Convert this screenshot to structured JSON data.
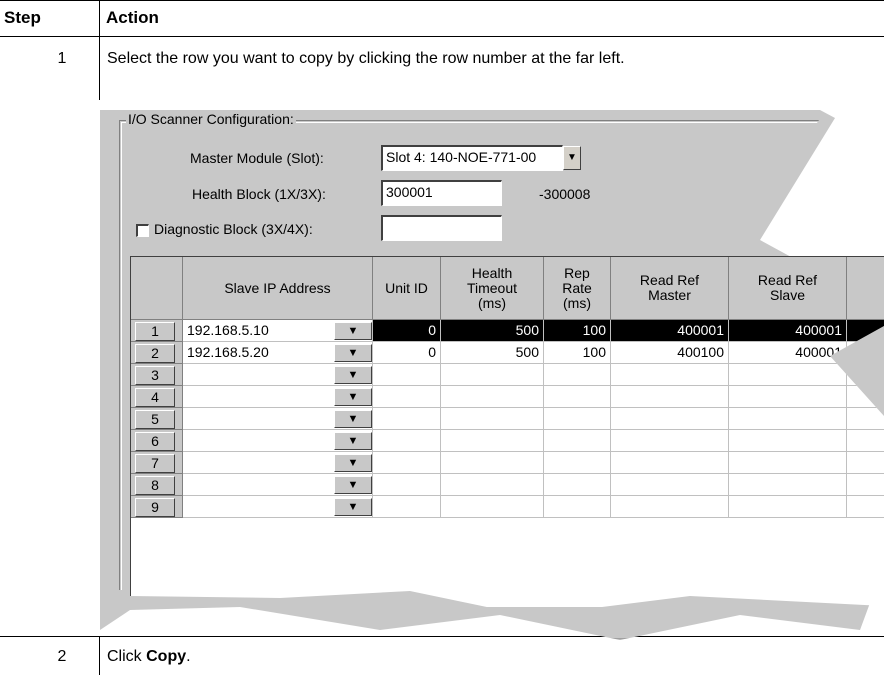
{
  "table": {
    "header_step": "Step",
    "header_action": "Action",
    "steps": [
      {
        "number": "1",
        "text": "Select the row you want to copy by clicking the row number at the far left."
      },
      {
        "number": "2",
        "text_prefix": "Click ",
        "text_bold": "Copy",
        "text_suffix": "."
      }
    ]
  },
  "screenshot": {
    "group_title": "I/O Scanner Configuration:",
    "master_module_label": "Master Module (Slot):",
    "master_module_value": "Slot 4: 140-NOE-771-00",
    "health_block_label": "Health Block (1X/3X):",
    "health_block_value": "300001",
    "health_block_end": "-300008",
    "diagnostic_block_label": "Diagnostic Block (3X/4X):",
    "diagnostic_block_checked": false,
    "diagnostic_block_value": "",
    "grid": {
      "columns": [
        "",
        "Slave IP Address",
        "Unit ID",
        "Health\nTimeout\n(ms)",
        "Rep\nRate\n(ms)",
        "Read Ref\nMaster",
        "Read Ref\nSlave"
      ],
      "col_slave_ip": "Slave IP Address",
      "col_unit_id": "Unit ID",
      "col_health_timeout": "Health Timeout (ms)",
      "col_rep_rate": "Rep Rate (ms)",
      "col_read_master": "Read Ref Master",
      "col_read_slave": "Read Ref Slave",
      "selected_row": 1,
      "rows": [
        {
          "n": "1",
          "ip": "192.168.5.10",
          "unit": "0",
          "timeout": "500",
          "rate": "100",
          "master": "400001",
          "slave": "400001"
        },
        {
          "n": "2",
          "ip": "192.168.5.20",
          "unit": "0",
          "timeout": "500",
          "rate": "100",
          "master": "400100",
          "slave": "400001"
        },
        {
          "n": "3",
          "ip": "",
          "unit": "",
          "timeout": "",
          "rate": "",
          "master": "",
          "slave": ""
        },
        {
          "n": "4",
          "ip": "",
          "unit": "",
          "timeout": "",
          "rate": "",
          "master": "",
          "slave": ""
        },
        {
          "n": "5",
          "ip": "",
          "unit": "",
          "timeout": "",
          "rate": "",
          "master": "",
          "slave": ""
        },
        {
          "n": "6",
          "ip": "",
          "unit": "",
          "timeout": "",
          "rate": "",
          "master": "",
          "slave": ""
        },
        {
          "n": "7",
          "ip": "",
          "unit": "",
          "timeout": "",
          "rate": "",
          "master": "",
          "slave": ""
        },
        {
          "n": "8",
          "ip": "",
          "unit": "",
          "timeout": "",
          "rate": "",
          "master": "",
          "slave": ""
        },
        {
          "n": "9",
          "ip": "",
          "unit": "",
          "timeout": "",
          "rate": "",
          "master": "",
          "slave": ""
        }
      ]
    }
  }
}
